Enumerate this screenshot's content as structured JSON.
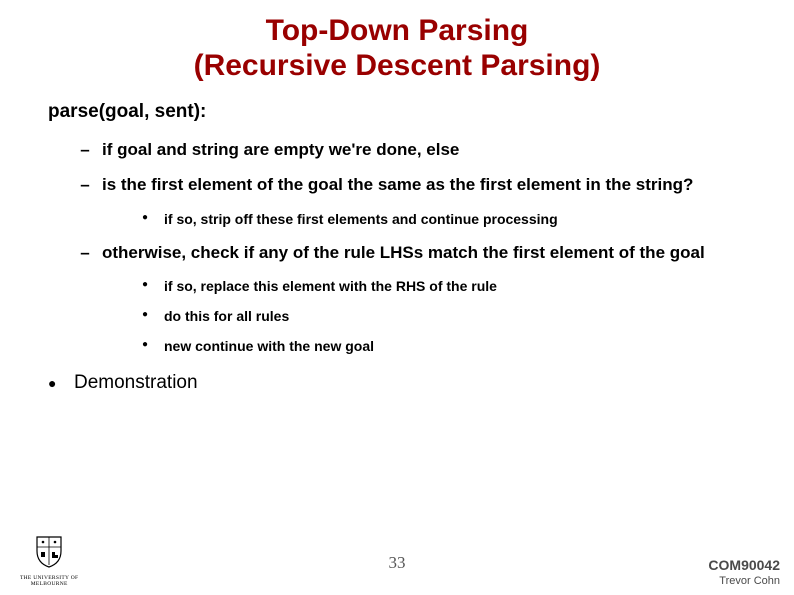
{
  "title_line1": "Top-Down Parsing",
  "title_line2": "(Recursive Descent Parsing)",
  "subheading": "parse(goal, sent):",
  "items": [
    {
      "text": "if goal and string are empty we're done, else",
      "sub": []
    },
    {
      "text": "is the first element of the goal the same as the first element in the string?",
      "sub": [
        "if so, strip off these first elements and continue processing"
      ]
    },
    {
      "text": "otherwise, check if any of the rule LHSs match the first element of the goal",
      "sub": [
        "if so, replace this element with the RHS of the rule",
        "do this for all rules",
        "new continue with the new goal"
      ]
    }
  ],
  "demo": "Demonstration",
  "logo_text": "THE UNIVERSITY OF\nMELBOURNE",
  "page_number": "33",
  "course_code": "COM90042",
  "author": "Trevor Cohn"
}
